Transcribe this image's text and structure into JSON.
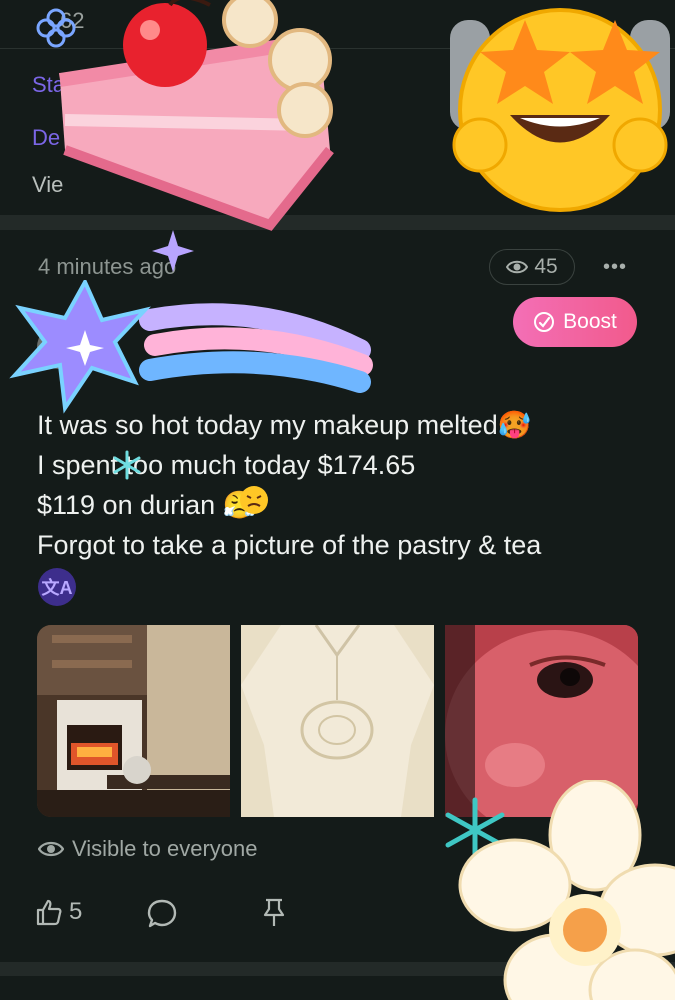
{
  "top": {
    "count_text": "62",
    "link_1": "Starry",
    "link_2": "De",
    "view_text": "Vie"
  },
  "post": {
    "time_ago": "4 minutes ago",
    "views": "45",
    "more_label": "•••",
    "boost_label": "Boost",
    "author": "...",
    "lines": [
      "It was so hot today my makeup melted🥵",
      "I spent too much today $174.65",
      "$119 on durian 😤",
      "Forgot to take a picture of the pastry & tea"
    ],
    "translate_icon": "文A",
    "visibility": "Visible to everyone",
    "likes": "5"
  },
  "colors": {
    "background": "#141b19",
    "accent_purple": "#7b66e6",
    "boost_pink": "#f36fb6"
  },
  "icons": {
    "eye": "eye-icon",
    "thumb": "thumbs-up-icon",
    "comment": "comment-icon",
    "pin": "pin-icon",
    "boost": "boost-icon"
  }
}
